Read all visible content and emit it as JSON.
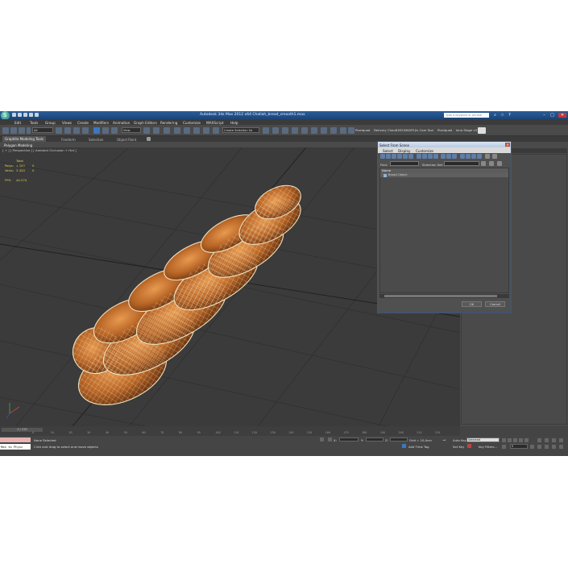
{
  "window": {
    "title": "Autodesk 3ds Max 2012 x64    Challah_bread_smooth1.max",
    "search_placeholder": "Type a keyword or phrase"
  },
  "menu": [
    "Edit",
    "Tools",
    "Group",
    "Views",
    "Create",
    "Modifiers",
    "Animation",
    "Graph Editors",
    "Rendering",
    "Customize",
    "MAXScript",
    "Help"
  ],
  "toolbar": {
    "filter_dropdown": "All",
    "view_dropdown": "View",
    "selection_set_dropdown": "Create Selection Se",
    "right_items": [
      "Pixelquad",
      "Delivery Check",
      "CHECKMATE",
      "Jiv Cam Tool",
      "Pixelquad",
      "leno Stage v3"
    ]
  },
  "ribbon": {
    "tabs": [
      "Graphite Modeling Tools",
      "Freeform",
      "Selection",
      "Object Paint"
    ],
    "subtitle": "Polygon Modeling"
  },
  "viewport": {
    "label": "[ + ] [ Perspective ] [ Ambient Occlusion + Hrd ]",
    "stats": {
      "total_label": "Total",
      "polys_label": "Polys:",
      "polys_total": "3 360",
      "polys_sel": "0",
      "verts_label": "Verts:",
      "verts_total": "3 420",
      "verts_sel": "0",
      "fps_label": "FPS:",
      "fps_value": "44.374"
    }
  },
  "dialog": {
    "title": "Select From Scene",
    "menu": [
      "Select",
      "Display",
      "Customize"
    ],
    "find_label": "Find:",
    "selection_set_label": "Selection Set:",
    "column_name": "Name",
    "items": [
      "Bread-Object"
    ],
    "ok_label": "OK",
    "cancel_label": "Cancel"
  },
  "timeline": {
    "slider_label": "0 / 225",
    "ticks": [
      "0",
      "10",
      "20",
      "30",
      "40",
      "50",
      "60",
      "70",
      "80",
      "90",
      "100",
      "110",
      "120",
      "130",
      "140",
      "150",
      "160",
      "170",
      "180",
      "190",
      "200",
      "210",
      "220"
    ]
  },
  "status": {
    "selection": "None Selected",
    "prompt": "Click and drag to select and move objects",
    "grid": "Grid = 10,0cm",
    "add_time_tag": "Add Time Tag",
    "auto_key_label": "Auto Key",
    "auto_key_value": "Selected",
    "set_key_label": "Set Key",
    "key_filters": "Key Filters...",
    "frame_value": "0",
    "maxscript_text": "Max to Physc",
    "x_label": "X:",
    "y_label": "Y:",
    "z_label": "Z:"
  },
  "colors": {
    "title_bar": "#1f4a7e",
    "viewport_bg": "#3b3b3b",
    "stats_text": "#e8d24a",
    "bread": "#b86526",
    "wireframe": "#f1e2bd"
  }
}
